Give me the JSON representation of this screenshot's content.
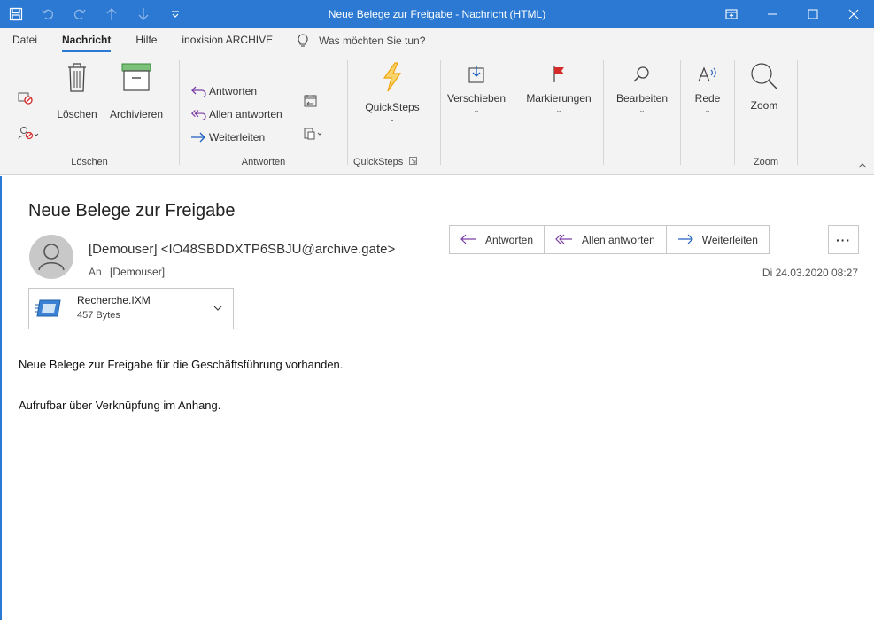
{
  "window": {
    "title": "Neue Belege zur Freigabe  -  Nachricht (HTML)",
    "qat_icons": [
      "save-icon",
      "undo-icon",
      "redo-icon",
      "up-arrow-icon",
      "down-arrow-icon",
      "customize-qat-icon"
    ],
    "controls": [
      "ribbon-display-icon",
      "minimize-icon",
      "maximize-icon",
      "close-icon"
    ]
  },
  "tabs": [
    "Datei",
    "Nachricht",
    "Hilfe",
    "inoxision ARCHIVE"
  ],
  "active_tab": "Nachricht",
  "tell_me": "Was möchten Sie tun?",
  "ribbon": {
    "loeschen_group": {
      "label": "Löschen",
      "delete": "Löschen",
      "archive": "Archivieren"
    },
    "antworten_group": {
      "label": "Antworten",
      "reply": "Antworten",
      "reply_all": "Allen antworten",
      "forward": "Weiterleiten"
    },
    "quicksteps_group": {
      "label": "QuickSteps",
      "button": "QuickSteps"
    },
    "move": "Verschieben",
    "tags": "Markierungen",
    "edit": "Bearbeiten",
    "speech": "Rede",
    "zoom_group": {
      "label": "Zoom",
      "button": "Zoom"
    }
  },
  "message": {
    "subject": "Neue Belege zur Freigabe",
    "sender": "[Demouser] <IO48SBDDXTP6SBJU@archive.gate>",
    "to_label": "An",
    "to_value": "[Demouser]",
    "date": "Di 24.03.2020 08:27",
    "actions": {
      "reply": "Antworten",
      "reply_all": "Allen antworten",
      "forward": "Weiterleiten",
      "more": "···"
    },
    "attachment": {
      "name": "Recherche.IXM",
      "size": "457 Bytes"
    },
    "body": [
      "Neue Belege zur Freigabe für die Geschäftsführung vorhanden.",
      "Aufrufbar über Verknüpfung im Anhang."
    ]
  },
  "colors": {
    "accent": "#2b79d3",
    "ribbon_bg": "#f3f3f3",
    "reply_purple": "#7b3fa6",
    "forward_blue": "#1e5fbf",
    "quicksteps_orange": "#f0a30a",
    "flag_red": "#d42a2a"
  }
}
